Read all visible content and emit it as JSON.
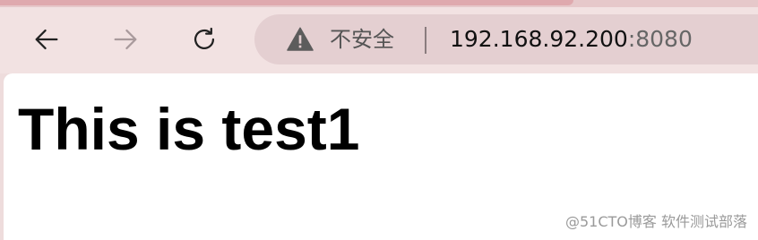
{
  "browser": {
    "toolbar": {
      "back_icon": "arrow-left-icon",
      "forward_icon": "arrow-right-icon",
      "reload_icon": "reload-icon"
    },
    "omnibox": {
      "security_icon": "warning-icon",
      "security_label": "不安全",
      "url_host": "192.168.92.200",
      "url_port": ":8080"
    }
  },
  "page": {
    "heading": "This is test1"
  },
  "watermark": "@51CTO博客 软件测试部落",
  "colors": {
    "toolbar": "#f2e2e2",
    "omnibox": "#e4cfd1",
    "active_tab": "#dfa9ae",
    "content_bg": "#ffffff"
  }
}
